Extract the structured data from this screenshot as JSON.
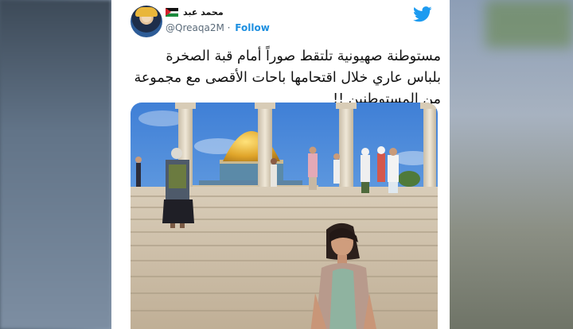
{
  "tweet": {
    "display_name": "محمد عبد",
    "handle": "@Qreaqa2M",
    "separator": "·",
    "follow_label": "Follow",
    "text": "مستوطنة صهيونية تلتقط صوراً أمام قبة الصخرة بلباس عاري خلال اقتحامها باحات الأقصى مع مجموعة من المستوطنين !!"
  },
  "colors": {
    "accent": "#1d8fe0",
    "handle": "#5b6b7a",
    "text": "#111111"
  },
  "icons": {
    "brand": "twitter-bird-icon",
    "flag": "palestine-flag-icon"
  }
}
